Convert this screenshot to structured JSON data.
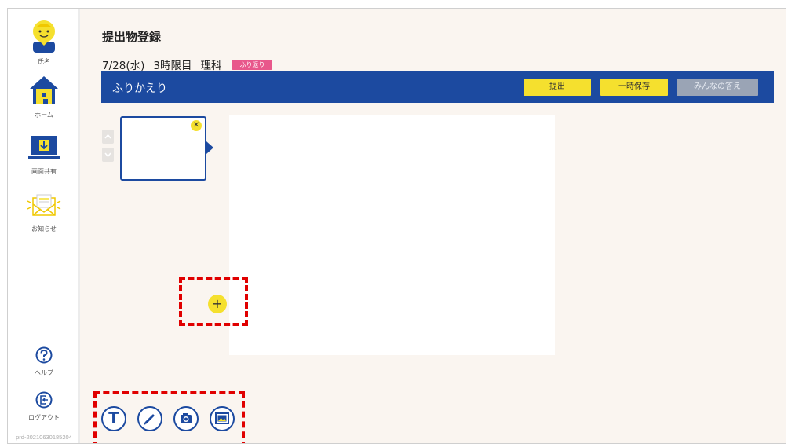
{
  "sidebar": {
    "items": [
      {
        "label": "氏名",
        "icon": "avatar-icon"
      },
      {
        "label": "ホーム",
        "icon": "home-icon"
      },
      {
        "label": "画面共有",
        "icon": "screen-share-icon"
      },
      {
        "label": "お知らせ",
        "icon": "mail-icon"
      },
      {
        "label": "ヘルプ",
        "icon": "help-icon"
      },
      {
        "label": "ログアウト",
        "icon": "logout-icon"
      }
    ],
    "build": "prd-20210630185204"
  },
  "header": {
    "title": "提出物登録",
    "date": "7/28(水)",
    "period": "3時限目",
    "subject": "理科",
    "tag": "ふり返り"
  },
  "bar": {
    "title": "ふりかえり",
    "submit": "提出",
    "save": "一時保存",
    "answers": "みんなの答え"
  },
  "controls": {
    "add": "+",
    "delete": "✕"
  },
  "tools": [
    {
      "name": "text-tool",
      "glyph": "T"
    },
    {
      "name": "pen-tool"
    },
    {
      "name": "camera-tool"
    },
    {
      "name": "image-tool"
    }
  ],
  "colors": {
    "primary": "#1c4aa0",
    "accent": "#f5e02e",
    "tag": "#e8578b",
    "highlight": "#e00000"
  }
}
